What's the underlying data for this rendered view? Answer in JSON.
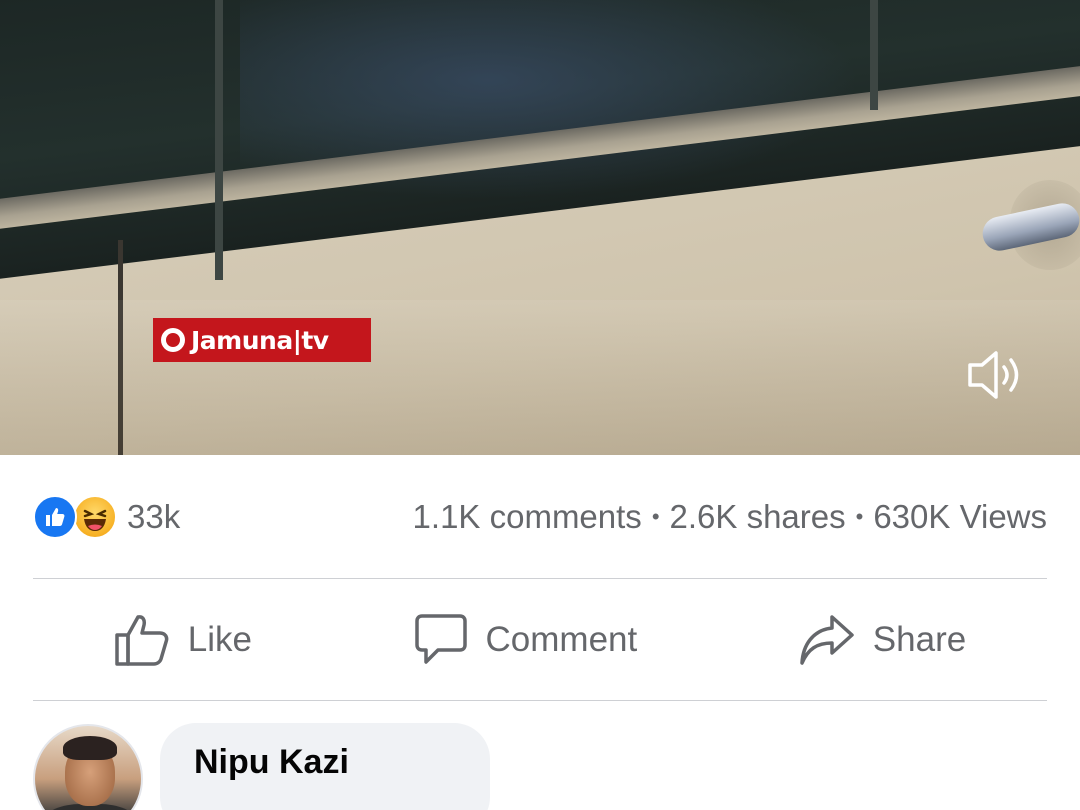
{
  "video": {
    "channel_logo_text": "Jamuna|tv",
    "sound_icon": "speaker-volume-icon"
  },
  "stats": {
    "reaction_icons": [
      "like-reaction-icon",
      "haha-reaction-icon"
    ],
    "reaction_count": "33k",
    "comments": "1.1K comments",
    "shares": "2.6K shares",
    "views": "630K Views",
    "separator": "•"
  },
  "actions": {
    "like_label": "Like",
    "comment_label": "Comment",
    "share_label": "Share"
  },
  "comment": {
    "author": "Nipu Kazi",
    "text": ""
  },
  "colors": {
    "facebook_blue": "#1877f2",
    "logo_red": "#c4161c",
    "secondary_text": "#65676b",
    "bubble_bg": "#f0f2f5"
  }
}
